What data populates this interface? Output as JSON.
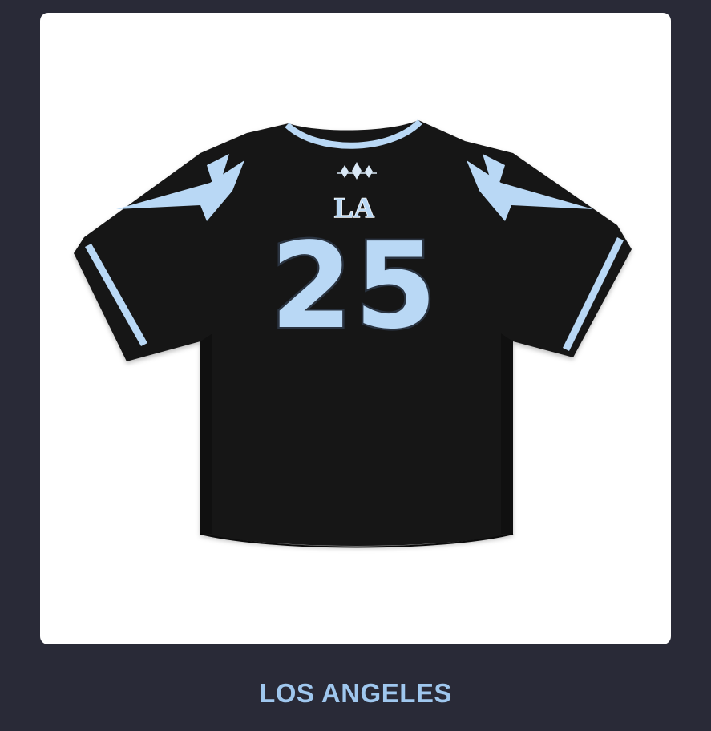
{
  "product": {
    "jersey_city_label": "LA",
    "jersey_number": "25",
    "caption": "LOS ANGELES"
  },
  "colors": {
    "background": "#292a37",
    "card": "#ffffff",
    "jersey_body": "#161616",
    "jersey_trim": "#b9d8f5",
    "caption": "#9fc7ee"
  },
  "icons": {
    "brand_mark": "star-sparkle-logo-icon"
  }
}
